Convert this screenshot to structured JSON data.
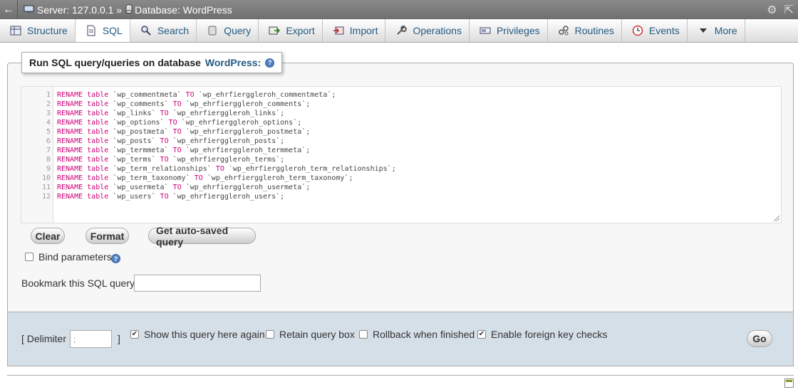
{
  "titlebar": {
    "server": "Server: 127.0.0.1 »",
    "database": "Database: WordPress"
  },
  "tabs": [
    {
      "label": "Structure",
      "icon": "structure-icon"
    },
    {
      "label": "SQL",
      "icon": "sql-icon"
    },
    {
      "label": "Search",
      "icon": "search-icon"
    },
    {
      "label": "Query",
      "icon": "query-icon"
    },
    {
      "label": "Export",
      "icon": "export-icon"
    },
    {
      "label": "Import",
      "icon": "import-icon"
    },
    {
      "label": "Operations",
      "icon": "wrench-icon"
    },
    {
      "label": "Privileges",
      "icon": "privileges-icon"
    },
    {
      "label": "Routines",
      "icon": "routines-icon"
    },
    {
      "label": "Events",
      "icon": "clock-icon"
    },
    {
      "label": "More",
      "icon": "chevron-down-icon"
    }
  ],
  "panel": {
    "legend_prefix": "Run SQL query/queries on database",
    "legend_db": "WordPress:",
    "help_glyph": "?"
  },
  "editor": {
    "lines": [
      {
        "n": "1",
        "kw1": "RENAME",
        "kw2": "table",
        "from": "`wp_commentmeta`",
        "kw3": "TO",
        "to": "`wp_ehrfierggleroh_commentmeta`;"
      },
      {
        "n": "2",
        "kw1": "RENAME",
        "kw2": "table",
        "from": "`wp_comments`",
        "kw3": "TO",
        "to": "`wp_ehrfierggleroh_comments`;"
      },
      {
        "n": "3",
        "kw1": "RENAME",
        "kw2": "table",
        "from": "`wp_links`",
        "kw3": "TO",
        "to": "`wp_ehrfierggleroh_links`;"
      },
      {
        "n": "4",
        "kw1": "RENAME",
        "kw2": "table",
        "from": "`wp_options`",
        "kw3": "TO",
        "to": "`wp_ehrfierggleroh_options`;"
      },
      {
        "n": "5",
        "kw1": "RENAME",
        "kw2": "table",
        "from": "`wp_postmeta`",
        "kw3": "TO",
        "to": "`wp_ehrfierggleroh_postmeta`;"
      },
      {
        "n": "6",
        "kw1": "RENAME",
        "kw2": "table",
        "from": "`wp_posts`",
        "kw3": "TO",
        "to": "`wp_ehrfierggleroh_posts`;"
      },
      {
        "n": "7",
        "kw1": "RENAME",
        "kw2": "table",
        "from": "`wp_termmeta`",
        "kw3": "TO",
        "to": "`wp_ehrfierggleroh_termmeta`;"
      },
      {
        "n": "8",
        "kw1": "RENAME",
        "kw2": "table",
        "from": "`wp_terms`",
        "kw3": "TO",
        "to": "`wp_ehrfierggleroh_terms`;"
      },
      {
        "n": "9",
        "kw1": "RENAME",
        "kw2": "table",
        "from": "`wp_term_relationships`",
        "kw3": "TO",
        "to": "`wp_ehrfierggleroh_term_relationships`;"
      },
      {
        "n": "10",
        "kw1": "RENAME",
        "kw2": "table",
        "from": "`wp_term_taxonomy`",
        "kw3": "TO",
        "to": "`wp_ehrfierggleroh_term_taxonomy`;"
      },
      {
        "n": "11",
        "kw1": "RENAME",
        "kw2": "table",
        "from": "`wp_usermeta`",
        "kw3": "TO",
        "to": "`wp_ehrfierggleroh_usermeta`;"
      },
      {
        "n": "12",
        "kw1": "RENAME",
        "kw2": "table",
        "from": "`wp_users`",
        "kw3": "TO",
        "to": "`wp_ehrfierggleroh_users`;"
      }
    ]
  },
  "buttons": {
    "clear": "Clear",
    "format": "Format",
    "autosaved": "Get auto-saved query",
    "go": "Go"
  },
  "bind_parameters": {
    "label": "Bind parameters",
    "checked": false
  },
  "bookmark": {
    "label": "Bookmark this SQL query:",
    "value": ""
  },
  "options": {
    "delimiter_label": "[ Delimiter",
    "delimiter_value": ";",
    "delimiter_close": "]",
    "show_again": {
      "label": "Show this query here again",
      "checked": true
    },
    "retain_box": {
      "label": "Retain query box",
      "checked": false
    },
    "rollback": {
      "label": "Rollback when finished",
      "checked": false
    },
    "foreign_keys": {
      "label": "Enable foreign key checks",
      "checked": true
    }
  },
  "colors": {
    "link_blue": "#235a81",
    "sql_keyword": "#cc0077",
    "options_bg": "#d5dfe8"
  }
}
